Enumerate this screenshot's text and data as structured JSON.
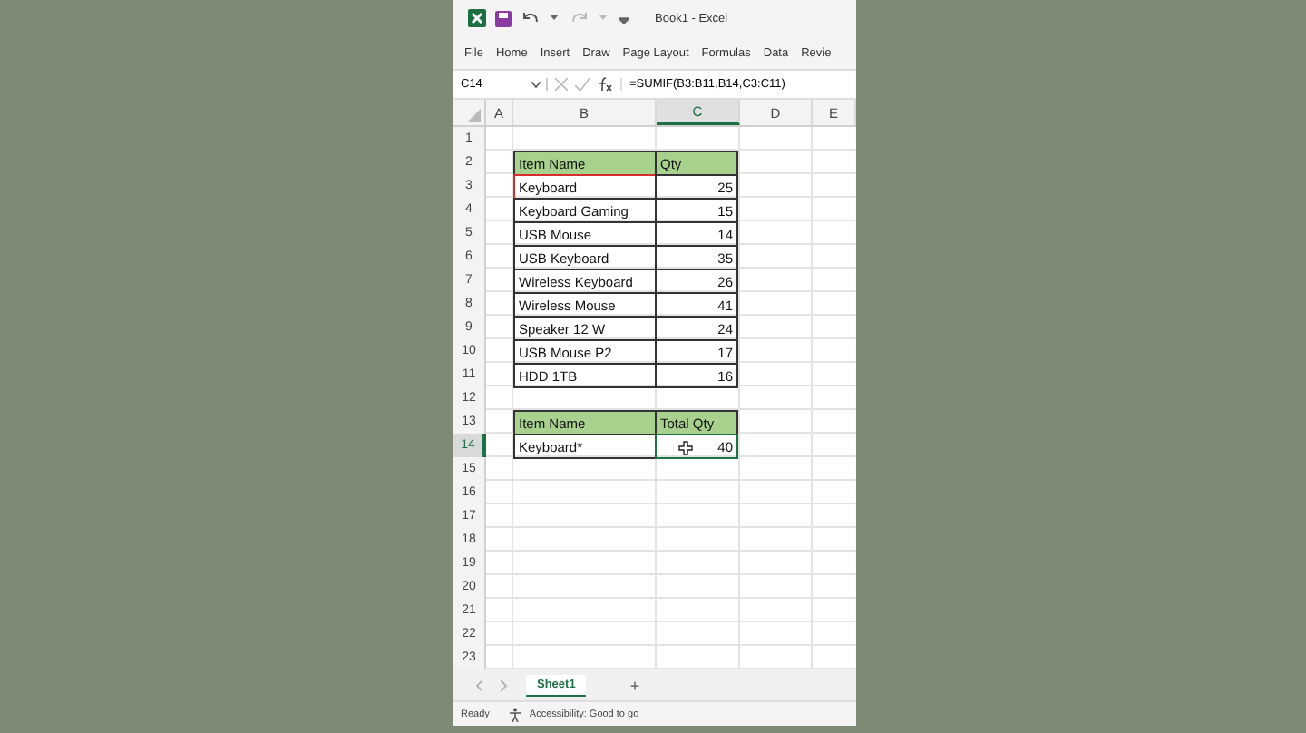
{
  "window": {
    "title": "Book1 - Excel"
  },
  "menu": [
    {
      "label": "File"
    },
    {
      "label": "Home"
    },
    {
      "label": "Insert"
    },
    {
      "label": "Draw"
    },
    {
      "label": "Page Layout"
    },
    {
      "label": "Formulas"
    },
    {
      "label": "Data"
    },
    {
      "label": "Revie"
    }
  ],
  "formula_bar": {
    "name_box": "C14",
    "formula": "=SUMIF(B3:B11,B14,C3:C11)"
  },
  "columns": [
    {
      "label": "A",
      "selected": false
    },
    {
      "label": "B",
      "selected": false
    },
    {
      "label": "C",
      "selected": true
    },
    {
      "label": "D",
      "selected": false
    },
    {
      "label": "E",
      "selected": false
    }
  ],
  "rows": [
    {
      "number": "1",
      "selected": false
    },
    {
      "number": "2",
      "selected": false,
      "cells": [
        {
          "text": "Item Name",
          "kind": "header",
          "selected": false,
          "outlined": false
        },
        {
          "text": "Qty",
          "kind": "header",
          "selected": false,
          "outlined": false
        }
      ]
    },
    {
      "number": "3",
      "selected": false,
      "cells": [
        {
          "text": "Keyboard",
          "kind": "text",
          "selected": false,
          "outlined": true
        },
        {
          "text": "25",
          "kind": "number",
          "selected": false,
          "outlined": false
        }
      ]
    },
    {
      "number": "4",
      "selected": false,
      "cells": [
        {
          "text": "Keyboard Gaming",
          "kind": "text",
          "selected": false,
          "outlined": false
        },
        {
          "text": "15",
          "kind": "number",
          "selected": false,
          "outlined": false
        }
      ]
    },
    {
      "number": "5",
      "selected": false,
      "cells": [
        {
          "text": "USB Mouse",
          "kind": "text",
          "selected": false,
          "outlined": false
        },
        {
          "text": "14",
          "kind": "number",
          "selected": false,
          "outlined": false
        }
      ]
    },
    {
      "number": "6",
      "selected": false,
      "cells": [
        {
          "text": "USB Keyboard",
          "kind": "text",
          "selected": false,
          "outlined": false
        },
        {
          "text": "35",
          "kind": "number",
          "selected": false,
          "outlined": false
        }
      ]
    },
    {
      "number": "7",
      "selected": false,
      "cells": [
        {
          "text": "Wireless Keyboard",
          "kind": "text",
          "selected": false,
          "outlined": false
        },
        {
          "text": "26",
          "kind": "number",
          "selected": false,
          "outlined": false
        }
      ]
    },
    {
      "number": "8",
      "selected": false,
      "cells": [
        {
          "text": "Wireless Mouse",
          "kind": "text",
          "selected": false,
          "outlined": false
        },
        {
          "text": "41",
          "kind": "number",
          "selected": false,
          "outlined": false
        }
      ]
    },
    {
      "number": "9",
      "selected": false,
      "cells": [
        {
          "text": "Speaker 12 W",
          "kind": "text",
          "selected": false,
          "outlined": false
        },
        {
          "text": "24",
          "kind": "number",
          "selected": false,
          "outlined": false
        }
      ]
    },
    {
      "number": "10",
      "selected": false,
      "cells": [
        {
          "text": "USB Mouse P2",
          "kind": "text",
          "selected": false,
          "outlined": false
        },
        {
          "text": "17",
          "kind": "number",
          "selected": false,
          "outlined": false
        }
      ]
    },
    {
      "number": "11",
      "selected": false,
      "cells": [
        {
          "text": "HDD 1TB",
          "kind": "text",
          "selected": false,
          "outlined": false
        },
        {
          "text": "16",
          "kind": "number",
          "selected": false,
          "outlined": false
        }
      ]
    },
    {
      "number": "12",
      "selected": false
    },
    {
      "number": "13",
      "selected": false,
      "cells": [
        {
          "text": "Item Name",
          "kind": "header",
          "selected": false,
          "outlined": false
        },
        {
          "text": "Total Qty",
          "kind": "header",
          "selected": false,
          "outlined": false
        }
      ]
    },
    {
      "number": "14",
      "selected": true,
      "cells": [
        {
          "text": "Keyboard*",
          "kind": "text",
          "selected": false,
          "outlined": false
        },
        {
          "text": "40",
          "kind": "number",
          "selected": true,
          "outlined": false
        }
      ]
    },
    {
      "number": "15",
      "selected": false
    },
    {
      "number": "16",
      "selected": false
    },
    {
      "number": "17",
      "selected": false
    },
    {
      "number": "18",
      "selected": false
    },
    {
      "number": "19",
      "selected": false
    },
    {
      "number": "20",
      "selected": false
    },
    {
      "number": "21",
      "selected": false
    },
    {
      "number": "22",
      "selected": false
    },
    {
      "number": "23",
      "selected": false
    }
  ],
  "sheet_tabs": [
    {
      "label": "Sheet1",
      "selected": true
    }
  ],
  "add_sheet": "+",
  "status_bar": {
    "ready": "Ready",
    "accessibility": "Accessibility: Good to go"
  }
}
